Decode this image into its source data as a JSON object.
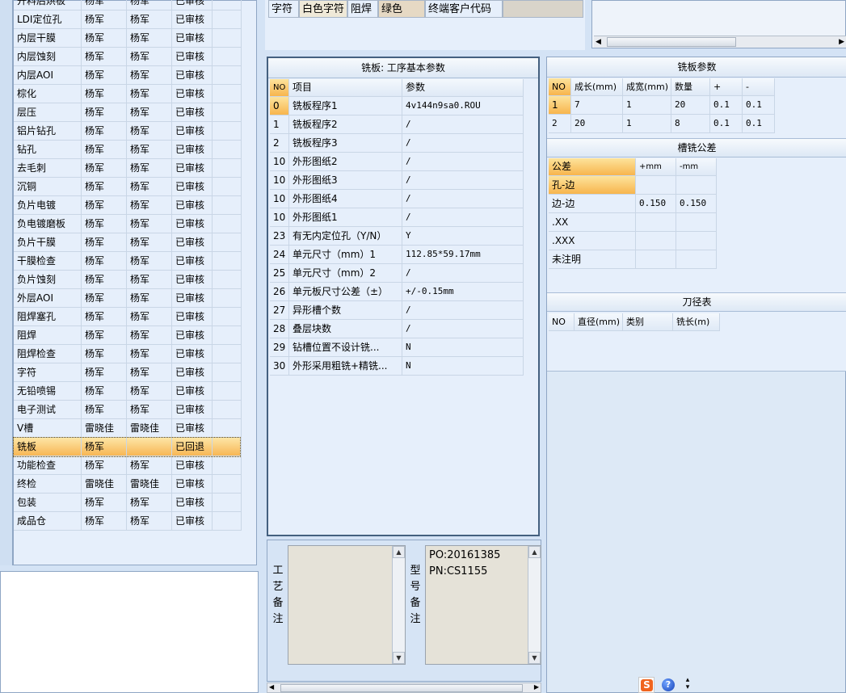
{
  "process_list": {
    "rows": [
      [
        "开料后烘板",
        "杨军",
        "杨军",
        "已审核"
      ],
      [
        "LDI定位孔",
        "杨军",
        "杨军",
        "已审核"
      ],
      [
        "内层干膜",
        "杨军",
        "杨军",
        "已审核"
      ],
      [
        "内层蚀刻",
        "杨军",
        "杨军",
        "已审核"
      ],
      [
        "内层AOI",
        "杨军",
        "杨军",
        "已审核"
      ],
      [
        "棕化",
        "杨军",
        "杨军",
        "已审核"
      ],
      [
        "层压",
        "杨军",
        "杨军",
        "已审核"
      ],
      [
        "铝片钻孔",
        "杨军",
        "杨军",
        "已审核"
      ],
      [
        "钻孔",
        "杨军",
        "杨军",
        "已审核"
      ],
      [
        "去毛刺",
        "杨军",
        "杨军",
        "已审核"
      ],
      [
        "沉铜",
        "杨军",
        "杨军",
        "已审核"
      ],
      [
        "负片电镀",
        "杨军",
        "杨军",
        "已审核"
      ],
      [
        "负电镀磨板",
        "杨军",
        "杨军",
        "已审核"
      ],
      [
        "负片干膜",
        "杨军",
        "杨军",
        "已审核"
      ],
      [
        "干膜检查",
        "杨军",
        "杨军",
        "已审核"
      ],
      [
        "负片蚀刻",
        "杨军",
        "杨军",
        "已审核"
      ],
      [
        "外层AOI",
        "杨军",
        "杨军",
        "已审核"
      ],
      [
        "阻焊塞孔",
        "杨军",
        "杨军",
        "已审核"
      ],
      [
        "阻焊",
        "杨军",
        "杨军",
        "已审核"
      ],
      [
        "阻焊检查",
        "杨军",
        "杨军",
        "已审核"
      ],
      [
        "字符",
        "杨军",
        "杨军",
        "已审核"
      ],
      [
        "无铅喷锡",
        "杨军",
        "杨军",
        "已审核"
      ],
      [
        "电子测试",
        "杨军",
        "杨军",
        "已审核"
      ],
      [
        "V槽",
        "雷晓佳",
        "雷晓佳",
        "已审核"
      ],
      [
        "铣板",
        "杨军",
        "",
        "已回退"
      ],
      [
        "功能检查",
        "杨军",
        "杨军",
        "已审核"
      ],
      [
        "终检",
        "雷晓佳",
        "雷晓佳",
        "已审核"
      ],
      [
        "包装",
        "杨军",
        "杨军",
        "已审核"
      ],
      [
        "成品仓",
        "杨军",
        "杨军",
        "已审核"
      ]
    ],
    "selected_index": 24
  },
  "attributes_bar": {
    "cells": [
      "字符",
      "白色字符",
      "阻焊",
      "绿色",
      "终端客户代码",
      ""
    ]
  },
  "basic_params": {
    "title": "铣板: 工序基本参数",
    "headers": [
      "NO",
      "项目",
      "参数"
    ],
    "rows": [
      [
        "0",
        "铣板程序1",
        "4v144n9sa0.ROU"
      ],
      [
        "1",
        "铣板程序2",
        "/"
      ],
      [
        "2",
        "铣板程序3",
        "/"
      ],
      [
        "10",
        "外形图纸2",
        "/"
      ],
      [
        "10",
        "外形图纸3",
        "/"
      ],
      [
        "10",
        "外形图纸4",
        "/"
      ],
      [
        "10",
        "外形图纸1",
        "/"
      ],
      [
        "23",
        "有无内定位孔（Y/N）",
        "Y"
      ],
      [
        "24",
        "单元尺寸（mm）1",
        "112.85*59.17mm"
      ],
      [
        "25",
        "单元尺寸（mm）2",
        "/"
      ],
      [
        "26",
        "单元板尺寸公差（±）",
        "+/-0.15mm"
      ],
      [
        "27",
        "异形槽个数",
        "/"
      ],
      [
        "28",
        "叠层块数",
        "/"
      ],
      [
        "29",
        "钻槽位置不设计铣...",
        "N"
      ],
      [
        "30",
        "外形采用粗铣+精铣...",
        "N"
      ]
    ]
  },
  "milling_params": {
    "title": "铣板参数",
    "headers": [
      "NO",
      "成长(mm)",
      "成宽(mm)",
      "数量",
      "+",
      "-"
    ],
    "rows": [
      [
        "1",
        "7",
        "1",
        "20",
        "0.1",
        "0.1"
      ],
      [
        "2",
        "20",
        "1",
        "8",
        "0.1",
        "0.1"
      ]
    ]
  },
  "slot_tolerance": {
    "title": "槽铣公差",
    "headers": [
      "公差",
      "+mm",
      "-mm"
    ],
    "rows": [
      [
        "孔-边",
        "",
        ""
      ],
      [
        "边-边",
        "0.150",
        "0.150"
      ],
      [
        ".XX",
        "",
        ""
      ],
      [
        ".XXX",
        "",
        ""
      ],
      [
        "未注明",
        "",
        ""
      ]
    ]
  },
  "tool_table": {
    "title": "刀径表",
    "headers": [
      "NO",
      "直径(mm)",
      "类别",
      "铣长(m)"
    ]
  },
  "notes": {
    "process_label": "工艺备注",
    "process_text": "",
    "model_label": "型号备注",
    "model_lines": [
      "PO:20161385",
      "PN:CS1155"
    ]
  },
  "colors": {
    "window_bg": "#d4e3f5",
    "grid_bg": "#e6effb",
    "selected": "#f7b54d"
  },
  "icons": [
    "sogou-ime-icon",
    "help-icon",
    "more-icon",
    "scroll-up-icon",
    "scroll-down-icon",
    "scroll-left-icon",
    "scroll-right-icon"
  ]
}
